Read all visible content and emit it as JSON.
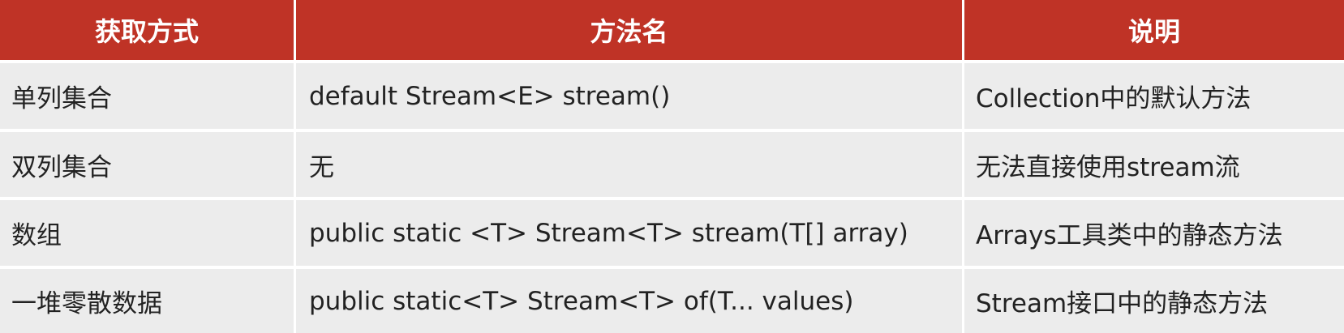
{
  "table": {
    "headers": [
      "获取方式",
      "方法名",
      "说明"
    ],
    "rows": [
      [
        "单列集合",
        "default Stream<E> stream()",
        "Collection中的默认方法"
      ],
      [
        "双列集合",
        "无",
        "无法直接使用stream流"
      ],
      [
        "数组",
        "public static <T> Stream<T> stream(T[] array)",
        "Arrays工具类中的静态方法"
      ],
      [
        "一堆零散数据",
        "public static<T> Stream<T> of(T... values)",
        "Stream接口中的静态方法"
      ]
    ]
  }
}
